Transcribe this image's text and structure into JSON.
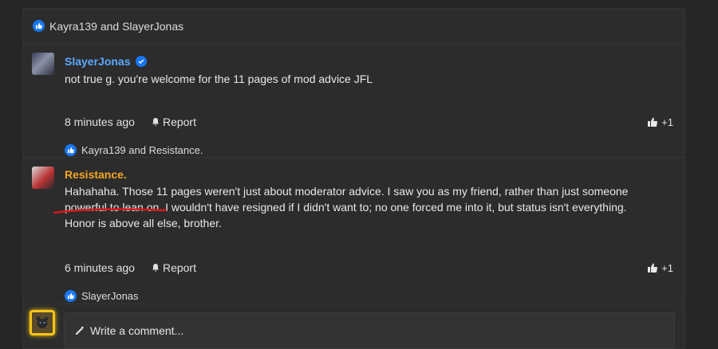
{
  "top_reactions": {
    "text": "Kayra139 and SlayerJonas"
  },
  "comments": [
    {
      "author": "SlayerJonas",
      "verified": true,
      "body": "not true g. you're welcome for the 11 pages of mod advice JFL",
      "time": "8 minutes ago",
      "report_label": "Report",
      "like_count": "+1",
      "reactions": "Kayra139 and Resistance."
    },
    {
      "author": "Resistance.",
      "verified": false,
      "body": "Hahahaha. Those 11 pages weren't just about moderator advice. I saw you as my friend, rather than just someone powerful to lean on. I wouldn't have resigned if I didn't want to; no one forced me into it, but status isn't everything. Honor is above all else, brother.",
      "time": "6 minutes ago",
      "report_label": "Report",
      "like_count": "+1",
      "reactions": "SlayerJonas"
    }
  ],
  "composer": {
    "placeholder": "Write a comment..."
  },
  "colors": {
    "accent": "#1877f2",
    "author_blue": "#5aa9ff",
    "author_orange": "#f4a623",
    "annotation_red": "#d9161a"
  }
}
